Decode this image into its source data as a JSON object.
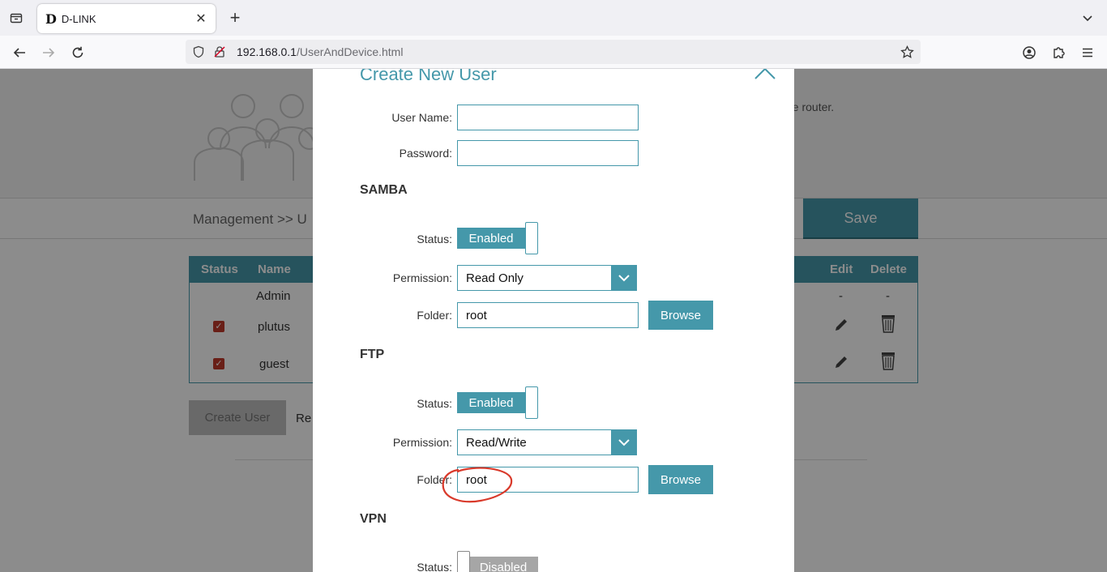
{
  "browser": {
    "tab_title": "D-LINK",
    "tab_favicon": "D",
    "url_host": "192.168.0.1",
    "url_path": "/UserAndDevice.html"
  },
  "page": {
    "hero_desc_fragment": "ne router.",
    "breadcrumb": "Management >> U",
    "save_label": "Save",
    "table": {
      "headers": [
        "Status",
        "Name",
        "Edit",
        "Delete"
      ],
      "rows": [
        {
          "name": "Admin",
          "checked": false,
          "edit": "-",
          "delete": "-"
        },
        {
          "name": "plutus",
          "checked": true
        },
        {
          "name": "guest",
          "checked": true
        }
      ]
    },
    "create_user_label": "Create User",
    "remove_fragment": "Re"
  },
  "modal": {
    "title": "Create New User",
    "username_label": "User Name:",
    "username_value": "",
    "password_label": "Password:",
    "password_value": "",
    "samba": {
      "heading": "SAMBA",
      "status_label": "Status:",
      "status_value": "Enabled",
      "permission_label": "Permission:",
      "permission_value": "Read Only",
      "folder_label": "Folder:",
      "folder_value": "root",
      "browse_label": "Browse"
    },
    "ftp": {
      "heading": "FTP",
      "status_label": "Status:",
      "status_value": "Enabled",
      "permission_label": "Permission:",
      "permission_value": "Read/Write",
      "folder_label": "Folder:",
      "folder_value": "root",
      "browse_label": "Browse"
    },
    "vpn": {
      "heading": "VPN",
      "status_label": "Status:",
      "status_value": "Disabled"
    }
  },
  "colors": {
    "accent": "#4598aa",
    "annotation": "#d93a2b",
    "checkbox": "#c0392b"
  }
}
